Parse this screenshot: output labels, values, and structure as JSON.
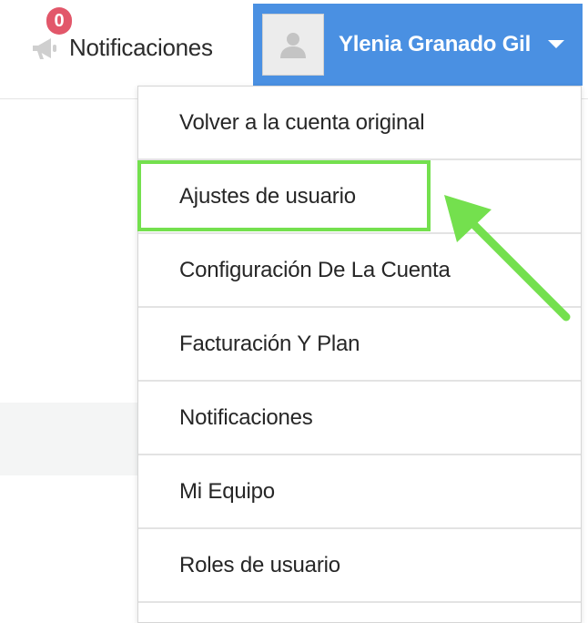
{
  "header": {
    "notifications_label": "Notificaciones",
    "notifications_count": "0",
    "user_name": "Ylenia Granado Gil"
  },
  "dropdown": {
    "items": [
      {
        "label": "Volver a la cuenta original"
      },
      {
        "label": "Ajustes de usuario",
        "highlighted": true
      },
      {
        "label": "Configuración De La Cuenta"
      },
      {
        "label": "Facturación Y Plan"
      },
      {
        "label": "Notificaciones"
      },
      {
        "label": "Mi Equipo"
      },
      {
        "label": "Roles de usuario"
      }
    ]
  },
  "icons": {
    "notifications": "megaphone-icon",
    "avatar": "user-silhouette-icon",
    "dropdown": "caret-down-icon"
  },
  "colors": {
    "user_button_bg": "#4a90e2",
    "badge_bg": "#e2576a",
    "highlight_annotation": "#74e04e"
  }
}
